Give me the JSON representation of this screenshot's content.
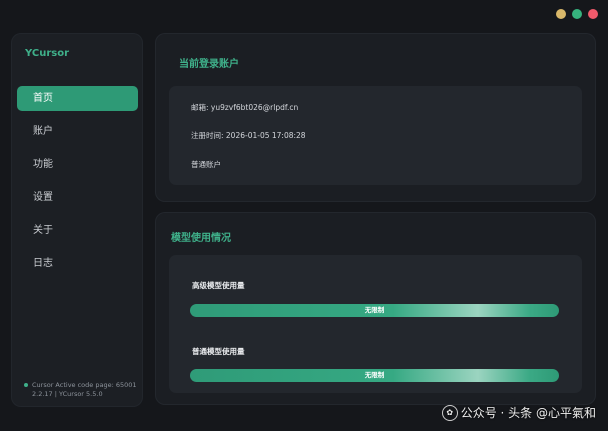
{
  "window": {
    "controls": {
      "colors": [
        "#d9b86a",
        "#36b37e",
        "#ef5a6b"
      ]
    }
  },
  "sidebar": {
    "brand": "YCursor",
    "items": [
      {
        "label": "首页",
        "active": true
      },
      {
        "label": "账户",
        "active": false
      },
      {
        "label": "功能",
        "active": false
      },
      {
        "label": "设置",
        "active": false
      },
      {
        "label": "关于",
        "active": false
      },
      {
        "label": "日志",
        "active": false
      }
    ],
    "footer_line1": "Cursor Active code page: 65001",
    "footer_line2": "2.2.17 | YCursor 5.5.0"
  },
  "account": {
    "title": "当前登录账户",
    "email": "邮箱: yu9zvf6bt026@rlpdf.cn",
    "registered": "注册时间: 2026-01-05 17:08:28",
    "type": "普通账户"
  },
  "usage": {
    "title": "模型使用情况",
    "premium_label": "高级模型使用量",
    "premium_value": "无限制",
    "premium_fraction": 1.0,
    "normal_label": "普通模型使用量",
    "normal_value": "无限制",
    "normal_fraction": 1.0
  },
  "watermark": {
    "text": "公众号 · 头条 @心平氣和"
  },
  "colors": {
    "accent": "#2e9a76",
    "accent_text": "#3fb08a",
    "background": "#15171b",
    "panel": "#1b1e23",
    "card": "#23272d"
  }
}
